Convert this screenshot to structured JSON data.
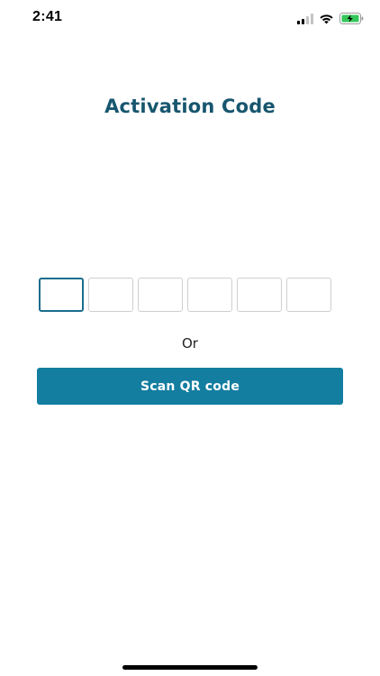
{
  "status_bar": {
    "time": "2:41",
    "icons": [
      "cellular-signal-icon",
      "wifi-icon",
      "battery-charging-icon"
    ]
  },
  "page": {
    "title": "Activation Code"
  },
  "code_input": {
    "digits": [
      "",
      "",
      "",
      "",
      "",
      ""
    ],
    "active_index": 0,
    "accent_color": "#1a6d8c"
  },
  "divider": {
    "or_label": "Or"
  },
  "actions": {
    "scan_label": "Scan QR code",
    "scan_color": "#137ea0"
  }
}
